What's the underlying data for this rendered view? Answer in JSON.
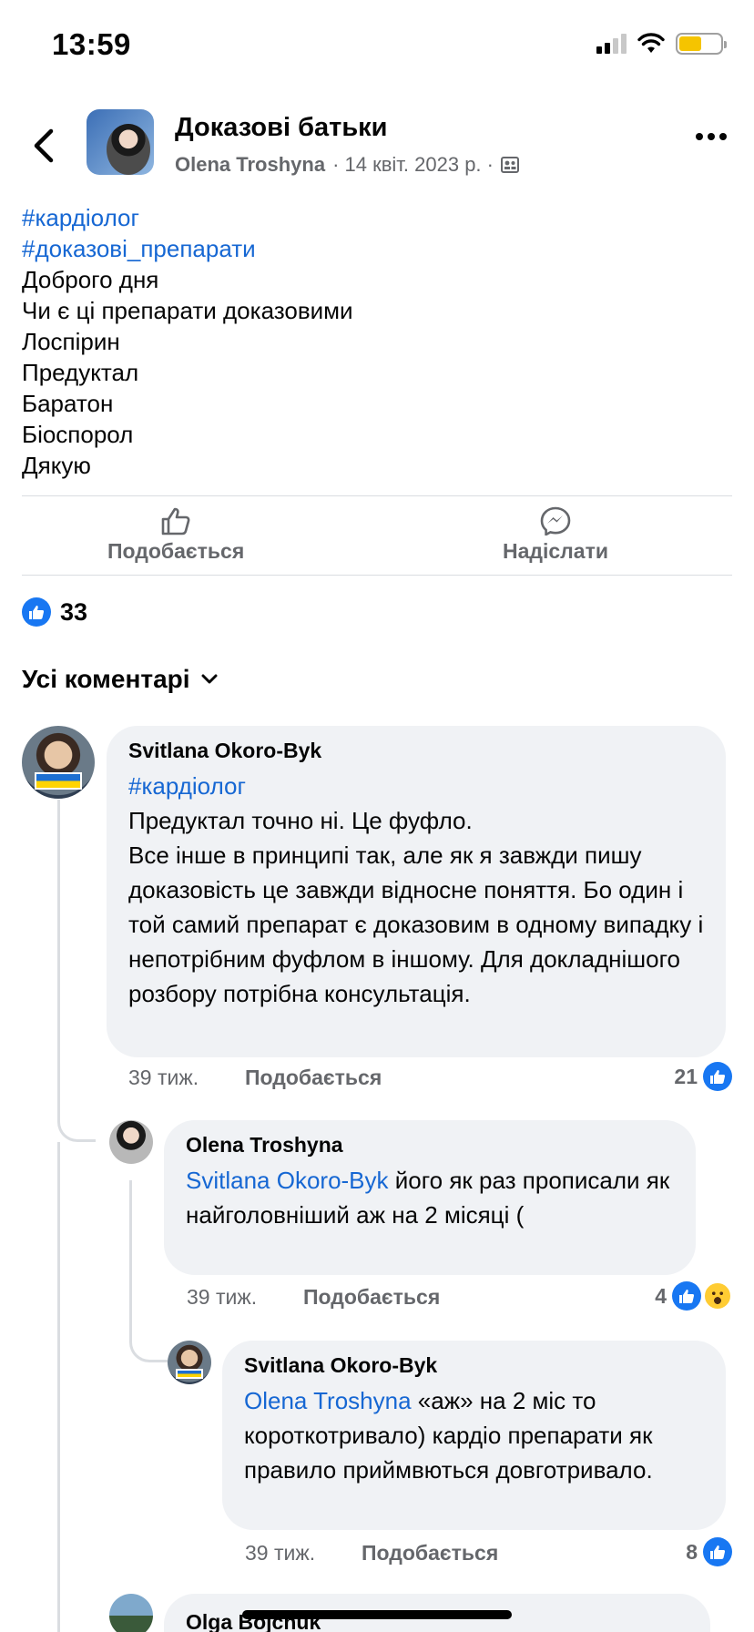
{
  "status_bar": {
    "time": "13:59",
    "battery_level": 0.55
  },
  "header": {
    "group_name": "Доказові батьки",
    "author": "Olena Troshyna",
    "date": "· 14 квіт. 2023 р. ·"
  },
  "post": {
    "hashtags": [
      "#кардіолог",
      "#доказові_препарати"
    ],
    "lines": [
      "Доброго дня",
      "Чи є ці препарати доказовими",
      "Лоспірин",
      "Предуктал",
      "Баратон",
      "Біоспорол",
      "Дякую"
    ]
  },
  "actions": {
    "like": "Подобається",
    "send": "Надіслати"
  },
  "reactions": {
    "count": "33"
  },
  "comments_filter": {
    "label": "Усі коментарі"
  },
  "comments": [
    {
      "author": "Svitlana Okoro-Byk",
      "mention": "#кардіолог",
      "text": "Предуктал точно ні. Це фуфло.\nВсе інше в принципі так, але як я завжди пишу доказовість це завжди відносне поняття. Бо один і той самий препарат є доказовим в одному випадку і непотрібним фуфлом в іншому. Для докладнішого розбору потрібна консультація.",
      "time": "39 тиж.",
      "like": "Подобається",
      "reactions": "21"
    },
    {
      "author": "Olena Troshyna",
      "mention": "Svitlana Okoro-Byk",
      "text": " його як раз прописали як найголовніший аж на 2 місяці (",
      "time": "39 тиж.",
      "like": "Подобається",
      "reactions": "4"
    },
    {
      "author": "Svitlana Okoro-Byk",
      "mention": "Olena Troshyna",
      "text": " «аж» на 2 міс то короткотривало) кардіо препарати як правило приймвються довготривало.",
      "time": "39 тиж.",
      "like": "Подобається",
      "reactions": "8"
    },
    {
      "author": "Olga Bojchuk"
    }
  ]
}
